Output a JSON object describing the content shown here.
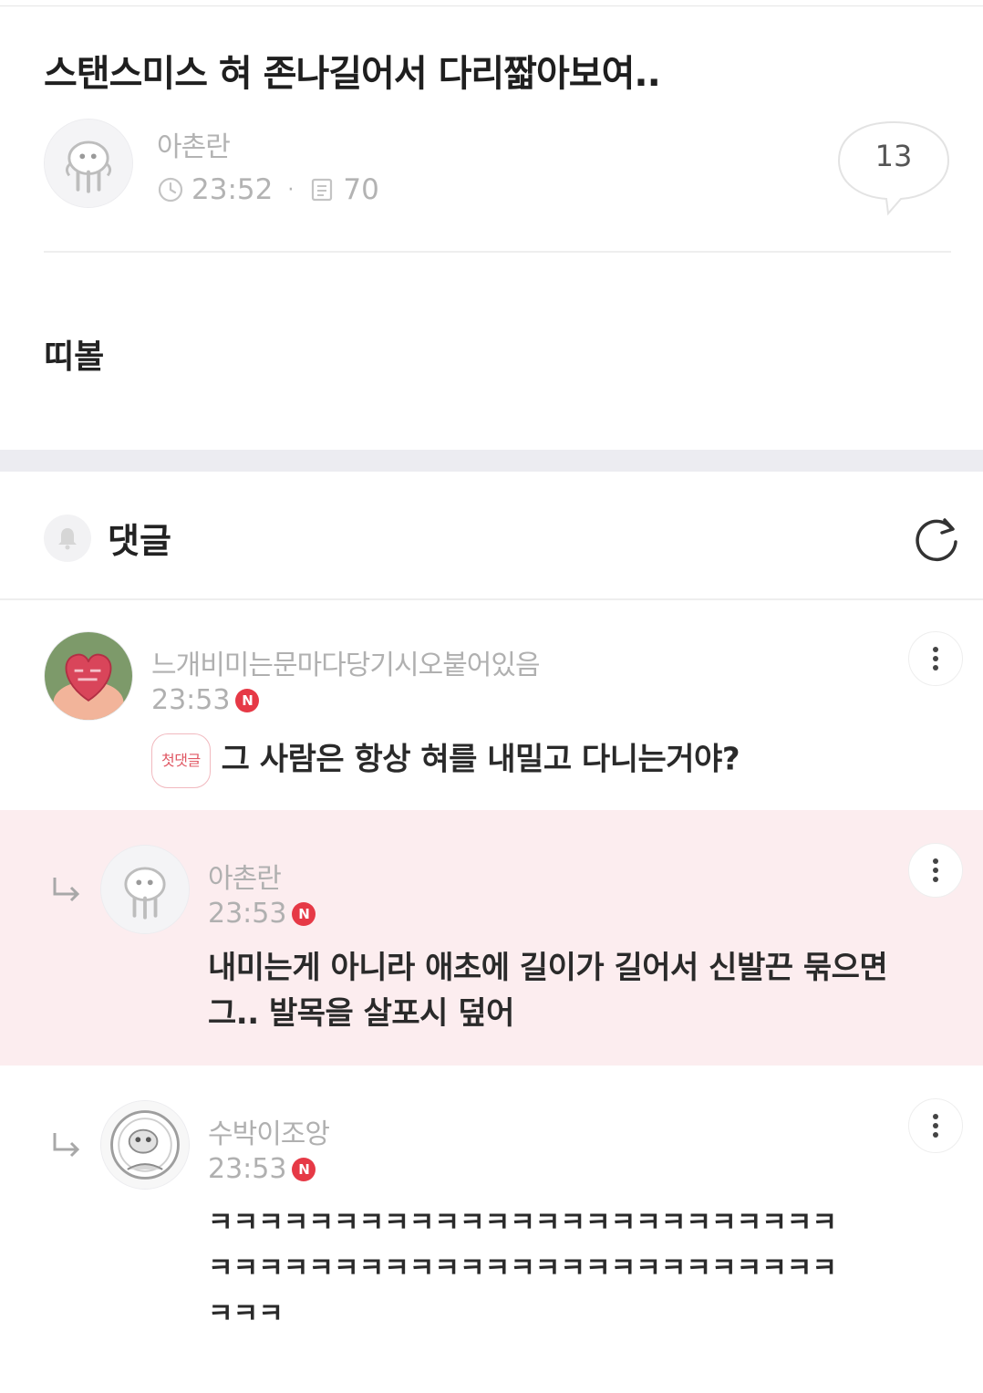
{
  "post": {
    "title": "스탠스미스 혀 존나길어서 다리짧아보여..",
    "author": "아촌란",
    "time": "23:52",
    "views": "70",
    "comment_count": "13",
    "body": "띠볼"
  },
  "comments_section": {
    "label": "댓글"
  },
  "comments": [
    {
      "author": "느개비미는문마다당기시오붙어있음",
      "time": "23:53",
      "new_badge": "N",
      "first_badge": "첫댓글",
      "text": "그 사람은 항상 혀를 내밀고 다니는거야?"
    },
    {
      "author": "아촌란",
      "time": "23:53",
      "new_badge": "N",
      "text_line1": "내미는게 아니라 애초에 길이가 길어서 신발끈 묶으면",
      "text_line2": "그.. 발목을 살포시 덮어"
    },
    {
      "author": "수박이조앙",
      "time": "23:53",
      "new_badge": "N",
      "text_line1": "ㅋㅋㅋㅋㅋㅋㅋㅋㅋㅋㅋㅋㅋㅋㅋㅋㅋㅋㅋㅋㅋㅋㅋㅋㅋ",
      "text_line2": "ㅋㅋㅋㅋㅋㅋㅋㅋㅋㅋㅋㅋㅋㅋㅋㅋㅋㅋㅋㅋㅋㅋㅋㅋㅋ",
      "text_line3": "ㅋㅋㅋ"
    }
  ],
  "icons": {
    "clock": "clock-icon",
    "views": "document-icon",
    "bubble": "speech-bubble-icon",
    "bell": "bell-icon",
    "refresh": "refresh-icon",
    "more": "more-vertical-icon",
    "reply": "reply-arrow-icon"
  },
  "colors": {
    "reply_highlight": "#fcedef",
    "new_badge": "#e63946",
    "muted_text": "#b0b0b0"
  }
}
